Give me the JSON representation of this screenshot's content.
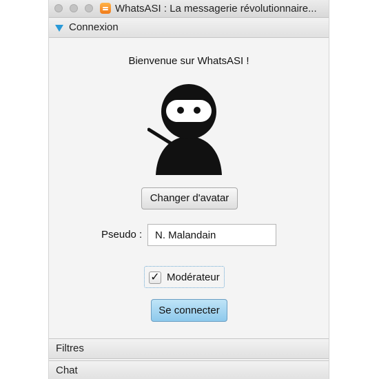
{
  "window": {
    "title": "WhatsASI : La messagerie révolutionnaire...",
    "traffic_lights": [
      "close",
      "minimize",
      "zoom"
    ]
  },
  "panes": {
    "connexion": {
      "label": "Connexion",
      "expanded": true
    },
    "filtres": {
      "label": "Filtres",
      "expanded": false
    },
    "chat": {
      "label": "Chat",
      "expanded": false
    }
  },
  "login": {
    "welcome": "Bienvenue sur WhatsASI !",
    "avatar_icon": "ninja-avatar-icon",
    "change_avatar_label": "Changer d'avatar",
    "pseudo_label": "Pseudo :",
    "pseudo_value": "N. Malandain",
    "moderator_label": "Modérateur",
    "moderator_checked": true,
    "connect_label": "Se connecter"
  },
  "colors": {
    "accent_arrow": "#2a9ad8",
    "connect_button": "#a9d7f1"
  }
}
